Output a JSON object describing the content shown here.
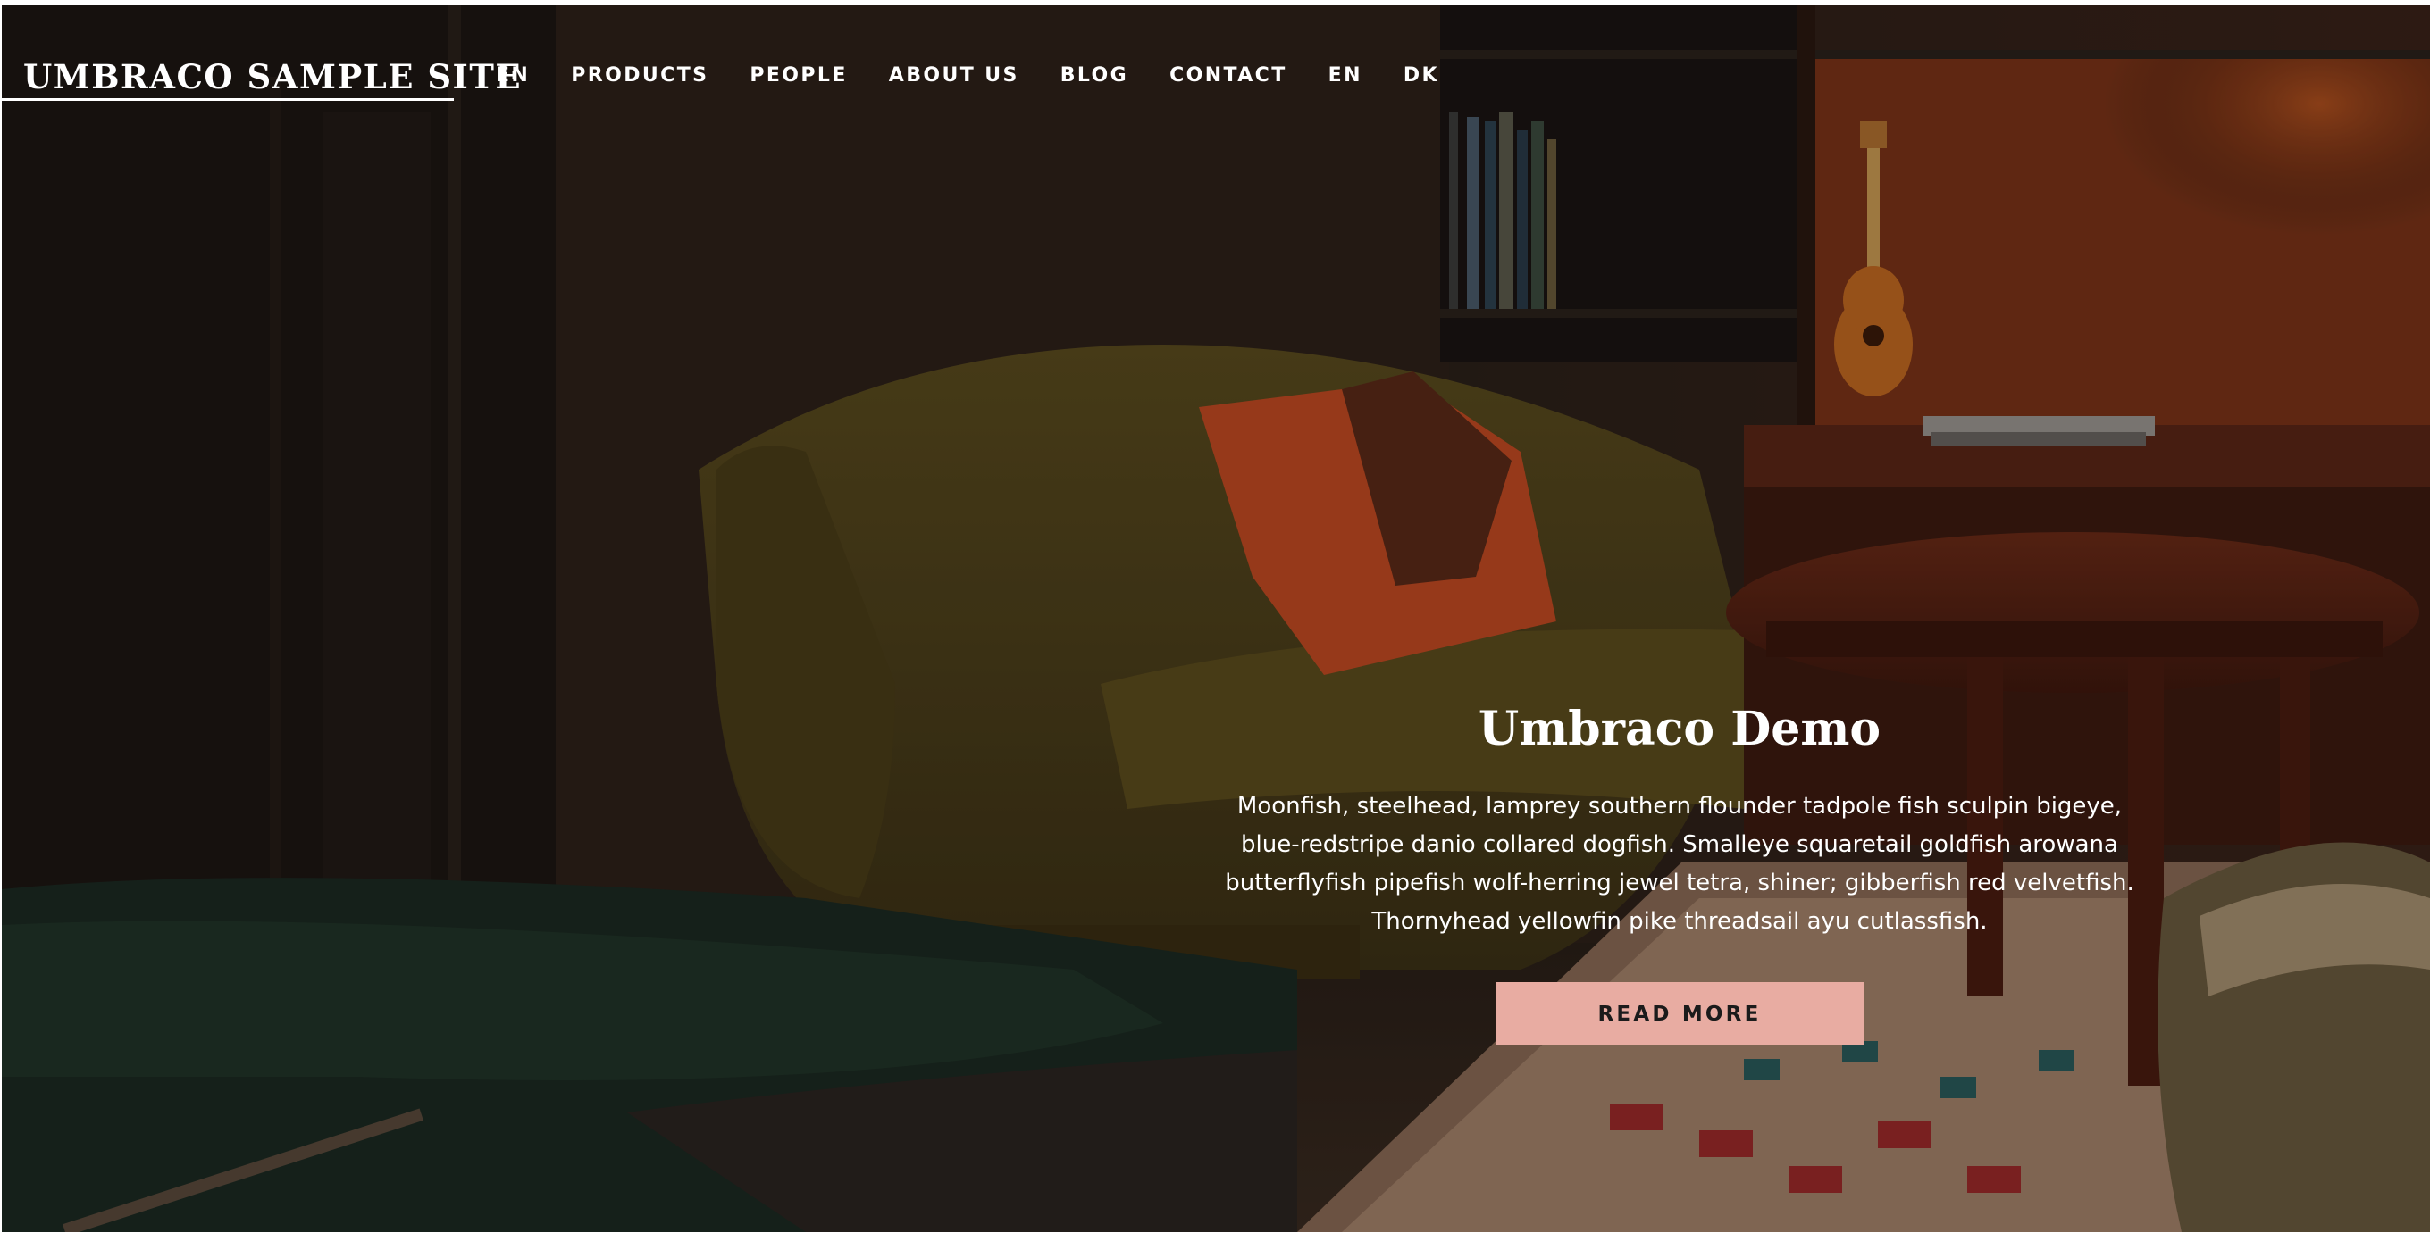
{
  "site": {
    "logo_text": "UMBRACO SAMPLE SITE"
  },
  "nav": {
    "items": [
      {
        "label": "EN"
      },
      {
        "label": "PRODUCTS"
      },
      {
        "label": "PEOPLE"
      },
      {
        "label": "ABOUT US"
      },
      {
        "label": "BLOG"
      },
      {
        "label": "CONTACT"
      },
      {
        "label": "EN"
      },
      {
        "label": "DK"
      }
    ]
  },
  "hero": {
    "title": "Umbraco Demo",
    "body": "Moonfish, steelhead, lamprey southern flounder tadpole fish sculpin bigeye, blue-redstripe danio collared dogfish. Smalleye squaretail goldfish arowana butterflyfish pipefish wolf-herring jewel tetra, shiner; gibberfish red velvetfish. Thornyhead yellowfin pike threadsail ayu cutlassfish.",
    "cta_label": "READ MORE"
  },
  "colors": {
    "text": "#ffffff",
    "cta_background": "#e8aca2",
    "cta_text": "#1b1b1b",
    "backdrop": "#1b1412"
  }
}
